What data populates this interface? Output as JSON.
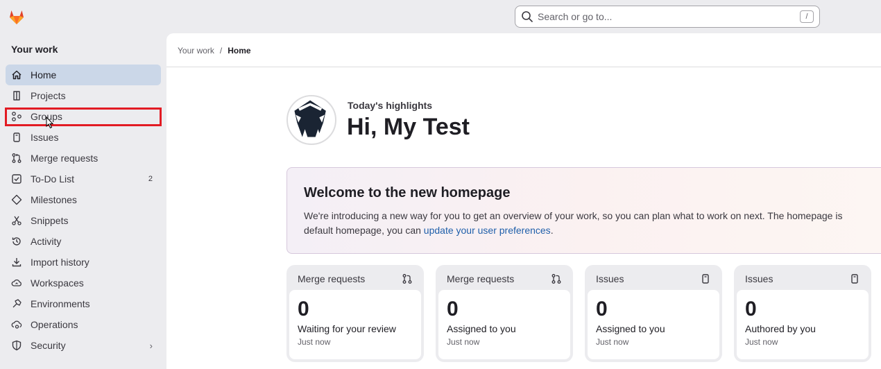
{
  "search": {
    "placeholder": "Search or go to...",
    "shortcut": "/"
  },
  "sidebar": {
    "title": "Your work",
    "items": [
      {
        "label": "Home",
        "icon": "home-icon",
        "active": true
      },
      {
        "label": "Projects",
        "icon": "project-icon"
      },
      {
        "label": "Groups",
        "icon": "group-icon"
      },
      {
        "label": "Issues",
        "icon": "issues-icon"
      },
      {
        "label": "Merge requests",
        "icon": "merge-request-icon"
      },
      {
        "label": "To-Do List",
        "icon": "todo-icon",
        "badge": "2"
      },
      {
        "label": "Milestones",
        "icon": "milestone-icon"
      },
      {
        "label": "Snippets",
        "icon": "snippet-icon"
      },
      {
        "label": "Activity",
        "icon": "history-icon"
      },
      {
        "label": "Import history",
        "icon": "download-icon"
      },
      {
        "label": "Workspaces",
        "icon": "workspace-icon"
      },
      {
        "label": "Environments",
        "icon": "environment-icon"
      },
      {
        "label": "Operations",
        "icon": "cloud-gear-icon"
      },
      {
        "label": "Security",
        "icon": "shield-icon",
        "chevron": "›"
      }
    ]
  },
  "breadcrumb": {
    "parent": "Your work",
    "separator": "/",
    "current": "Home"
  },
  "header": {
    "highlights": "Today's highlights",
    "greeting": "Hi, My Test"
  },
  "welcome": {
    "title": "Welcome to the new homepage",
    "text_before_link": "We're introducing a new way for you to get an overview of your work, so you can plan what to work on next. The homepage is",
    "text_line2": "default homepage, you can",
    "link": "update your user preferences",
    "text_after_link": "."
  },
  "cards": [
    {
      "title": "Merge requests",
      "icon": "merge-request-icon",
      "count": "0",
      "label": "Waiting for your review",
      "time": "Just now"
    },
    {
      "title": "Merge requests",
      "icon": "merge-request-icon",
      "count": "0",
      "label": "Assigned to you",
      "time": "Just now"
    },
    {
      "title": "Issues",
      "icon": "issues-icon",
      "count": "0",
      "label": "Assigned to you",
      "time": "Just now"
    },
    {
      "title": "Issues",
      "icon": "issues-icon",
      "count": "0",
      "label": "Authored by you",
      "time": "Just now"
    }
  ],
  "colors": {
    "accent": "#1f5faa",
    "active_nav": "#cbd7e8",
    "highlight_box": "#e21b23"
  }
}
